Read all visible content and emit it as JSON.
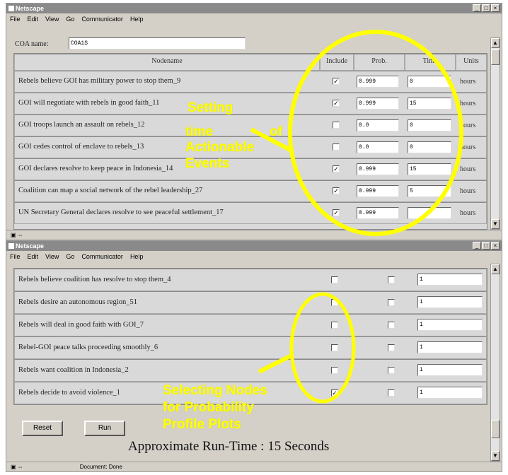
{
  "window1": {
    "title": "Netscape",
    "menu": [
      "File",
      "Edit",
      "View",
      "Go",
      "Communicator",
      "Help"
    ],
    "coa_label": "COA name:",
    "coa_value": "COA1S",
    "columns": [
      "Nodename",
      "Include",
      "Prob.",
      "Time",
      "Units"
    ],
    "rows": [
      {
        "name": "Rebels believe GOI has military power to stop them_9",
        "checked": true,
        "prob": "0.999",
        "time": "0",
        "units": "hours"
      },
      {
        "name": "GOI will negotiate with rebels in good faith_11",
        "checked": true,
        "prob": "0.999",
        "time": "15",
        "units": "hours"
      },
      {
        "name": "GOI troops launch an assault on rebels_12",
        "checked": false,
        "prob": "0.0",
        "time": "0",
        "units": "hours"
      },
      {
        "name": "GOI cedes control of enclave to rebels_13",
        "checked": false,
        "prob": "0.0",
        "time": "0",
        "units": "hours"
      },
      {
        "name": "GOI declares resolve to keep peace in Indonesia_14",
        "checked": true,
        "prob": "0.999",
        "time": "15",
        "units": "hours"
      },
      {
        "name": "Coalition can map a social network of the rebel leadership_27",
        "checked": true,
        "prob": "0.999",
        "time": "5",
        "units": "hours"
      },
      {
        "name": "UN Secretary General declares resolve to see peaceful settlement_17",
        "checked": true,
        "prob": "0.999",
        "time": "",
        "units": "hours"
      }
    ]
  },
  "window2": {
    "title": "Netscape",
    "menu": [
      "File",
      "Edit",
      "View",
      "Go",
      "Communicator",
      "Help"
    ],
    "rows": [
      {
        "name": "Rebels believe coalition has resolve to stop them_4",
        "include": false,
        "col2": false,
        "value": "1"
      },
      {
        "name": "Rebels desire an autonomous region_51",
        "include": false,
        "col2": false,
        "value": "1"
      },
      {
        "name": "Rebels will deal in good faith with GOI_7",
        "include": false,
        "col2": false,
        "value": "1"
      },
      {
        "name": "Rebel-GOI peace talks proceeding smoothly_6",
        "include": false,
        "col2": false,
        "value": "1"
      },
      {
        "name": "Rebels want coalition in Indonesia_2",
        "include": false,
        "col2": false,
        "value": "1"
      },
      {
        "name": "Rebels decide to avoid violence_1",
        "include": true,
        "col2": false,
        "value": "1"
      }
    ],
    "reset_label": "Reset",
    "run_label": "Run",
    "runtime_text": "Approximate Run-Time : 15 Seconds",
    "status_text": "Document: Done"
  },
  "annotations": {
    "setting_lines": [
      "Setting",
      "time",
      "of",
      "Actionable",
      "Events"
    ],
    "selecting_lines": [
      "Selecting Nodes",
      "for Probability",
      "Profile Plots"
    ]
  },
  "colors": {
    "annotation": "#ffff00",
    "chrome": "#d4d0c8",
    "titlebar": "#8a8a8a"
  }
}
